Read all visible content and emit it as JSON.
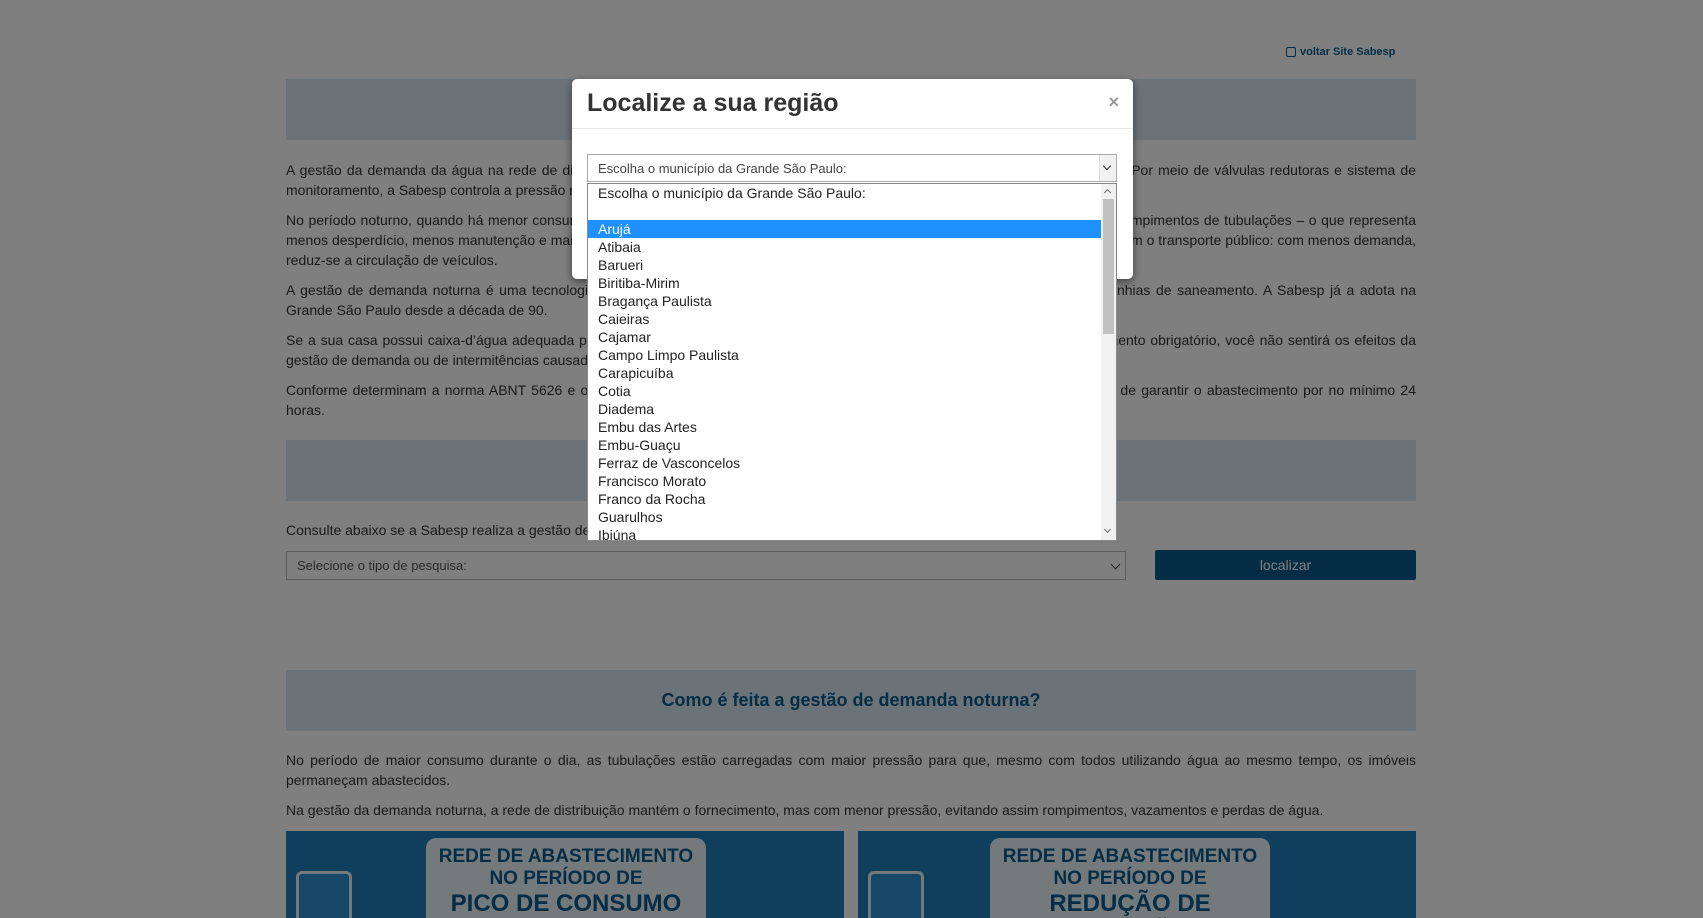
{
  "header": {
    "back_link": "voltar Site Sabesp"
  },
  "content": {
    "p1": "A gestão da demanda da água na rede de distribuição é uma prática adotada pelas principais empresas de saneamento do mundo. Por meio de válvulas redutoras e sistema de monitoramento, a Sabesp controla a pressão na rede nos horários de menor consumo, geralmente no período noturno.",
    "p2": "No período noturno, quando há menor consumo, a pressão na rede fica mais alta, o que aumenta a possibilidade de vazamentos e rompimentos de tubulações – o que representa menos desperdício, menos manutenção e mais qualidade no abastecimento. É o mesmo que acontece durante a noite, por exemplo, com o transporte público: com menos demanda, reduz-se a circulação de veículos.",
    "p3": "A gestão de demanda noturna é uma tecnologia utilizada mundialmente para controle de perdas e adotada pelas grandes companhias de saneamento. A Sabesp já a adota na Grande São Paulo desde a década de 90.",
    "p4": "Se a sua casa possui caixa-d’água adequada para o número de pessoas que moram no imóvel, conforme estabelecido no regulamento obrigatório, você não sentirá os efeitos da gestão de demanda ou de intermitências causadas por reparos nas redes.",
    "p5": "Conforme determinam a norma ABNT 5626 e o Decreto Estadual nº 12.342/1978, todos os imóveis devem ter caixa-d’água capaz de garantir o abastecimento por no mínimo 24 horas.",
    "p6": "Consulte abaixo se a Sabesp realiza a gestão de demanda noturna na sua região.",
    "search_select": "Selecione o tipo de pesquisa:",
    "search_button": "localizar",
    "section_title": "Como é feita a gestão de demanda noturna?",
    "p7": "No período de maior consumo durante o dia, as tubulações estão carregadas com maior pressão para que, mesmo com todos utilizando água ao mesmo tempo, os imóveis permaneçam abastecidos.",
    "p8": "Na gestão da demanda noturna, a rede de distribuição mantém o fornecimento, mas com menor pressão, evitando assim rompimentos, vazamentos e perdas de água.",
    "card1": {
      "l1": "REDE DE ABASTECIMENTO",
      "l2": "NO PERÍODO DE",
      "l3": "PICO DE CONSUMO"
    },
    "card2": {
      "l1": "REDE DE ABASTECIMENTO",
      "l2": "NO PERÍODO DE",
      "l3": "REDUÇÃO DE PRESSÃO"
    }
  },
  "modal": {
    "title": "Localize a sua região",
    "close": "×",
    "select_value": "Escolha o município da Grande São Paulo:",
    "options": [
      "Escolha o município da Grande São Paulo:",
      "",
      "Arujá",
      "Atibaia",
      "Barueri",
      "Biritiba-Mirim",
      "Bragança Paulista",
      "Caieiras",
      "Cajamar",
      "Campo Limpo Paulista",
      "Carapicuíba",
      "Cotia",
      "Diadema",
      "Embu das Artes",
      "Embu-Guaçu",
      "Ferraz de Vasconcelos",
      "Francisco Morato",
      "Franco da Rocha",
      "Guarulhos",
      "Ibiúna"
    ],
    "selected_index": 2
  }
}
